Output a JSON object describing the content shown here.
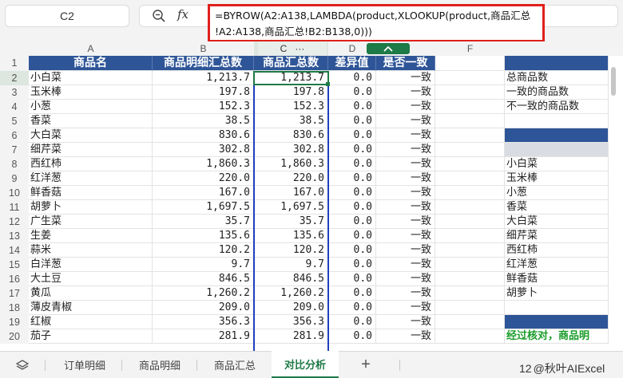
{
  "name_box": "C2",
  "formula_lines": [
    "=BYROW(A2:A138,LAMBDA(product,XLOOKUP(product,商品汇总",
    "!A2:A138,商品汇总!B2:B138,0)))"
  ],
  "columns": [
    "A",
    "B",
    "C",
    "D",
    "E",
    "F"
  ],
  "column_c_menu": "···",
  "headers": [
    "商品名",
    "商品明细汇总数",
    "商品汇总数",
    "差异值",
    "是否一致"
  ],
  "rows": [
    {
      "n": "2",
      "name": "小白菜",
      "b": "1,213.7",
      "c": "1,213.7",
      "d": "0.0",
      "e": "一致"
    },
    {
      "n": "3",
      "name": "玉米棒",
      "b": "197.8",
      "c": "197.8",
      "d": "0.0",
      "e": "一致"
    },
    {
      "n": "4",
      "name": "小葱",
      "b": "152.3",
      "c": "152.3",
      "d": "0.0",
      "e": "一致"
    },
    {
      "n": "5",
      "name": "香菜",
      "b": "38.5",
      "c": "38.5",
      "d": "0.0",
      "e": "一致"
    },
    {
      "n": "6",
      "name": "大白菜",
      "b": "830.6",
      "c": "830.6",
      "d": "0.0",
      "e": "一致"
    },
    {
      "n": "7",
      "name": "细芹菜",
      "b": "302.8",
      "c": "302.8",
      "d": "0.0",
      "e": "一致"
    },
    {
      "n": "8",
      "name": "西红柿",
      "b": "1,860.3",
      "c": "1,860.3",
      "d": "0.0",
      "e": "一致"
    },
    {
      "n": "9",
      "name": "红洋葱",
      "b": "220.0",
      "c": "220.0",
      "d": "0.0",
      "e": "一致"
    },
    {
      "n": "10",
      "name": "鲜香菇",
      "b": "167.0",
      "c": "167.0",
      "d": "0.0",
      "e": "一致"
    },
    {
      "n": "11",
      "name": "胡萝卜",
      "b": "1,697.5",
      "c": "1,697.5",
      "d": "0.0",
      "e": "一致"
    },
    {
      "n": "12",
      "name": "广生菜",
      "b": "35.7",
      "c": "35.7",
      "d": "0.0",
      "e": "一致"
    },
    {
      "n": "13",
      "name": "生姜",
      "b": "135.6",
      "c": "135.6",
      "d": "0.0",
      "e": "一致"
    },
    {
      "n": "14",
      "name": "蒜米",
      "b": "120.2",
      "c": "120.2",
      "d": "0.0",
      "e": "一致"
    },
    {
      "n": "15",
      "name": "白洋葱",
      "b": "9.7",
      "c": "9.7",
      "d": "0.0",
      "e": "一致"
    },
    {
      "n": "16",
      "name": "大土豆",
      "b": "846.5",
      "c": "846.5",
      "d": "0.0",
      "e": "一致"
    },
    {
      "n": "17",
      "name": "黄瓜",
      "b": "1,260.2",
      "c": "1,260.2",
      "d": "0.0",
      "e": "一致"
    },
    {
      "n": "18",
      "name": "薄皮青椒",
      "b": "209.0",
      "c": "209.0",
      "d": "0.0",
      "e": "一致"
    },
    {
      "n": "19",
      "name": "红椒",
      "b": "356.3",
      "c": "356.3",
      "d": "0.0",
      "e": "一致"
    },
    {
      "n": "20",
      "name": "茄子",
      "b": "281.9",
      "c": "281.9",
      "d": "0.0",
      "e": "一致"
    }
  ],
  "side_labels": [
    "总商品数",
    "一致的商品数",
    "不一致的商品数"
  ],
  "side_list": [
    "小白菜",
    "玉米棒",
    "小葱",
    "香菜",
    "大白菜",
    "细芹菜",
    "西红柿",
    "红洋葱",
    "鲜香菇",
    "胡萝卜"
  ],
  "side_footer": "经过核对，商品明",
  "tabs": [
    "订单明细",
    "商品明细",
    "商品汇总",
    "对比分析"
  ],
  "active_tab": "对比分析",
  "add_sheet": "+",
  "status_number": "12",
  "watermark": "@秋叶AIExcel",
  "colors": {
    "header_blue": "#2e5597",
    "accent_green": "#1e7a46",
    "highlight_red": "#e0201c",
    "selected_col": "#dde7df"
  }
}
